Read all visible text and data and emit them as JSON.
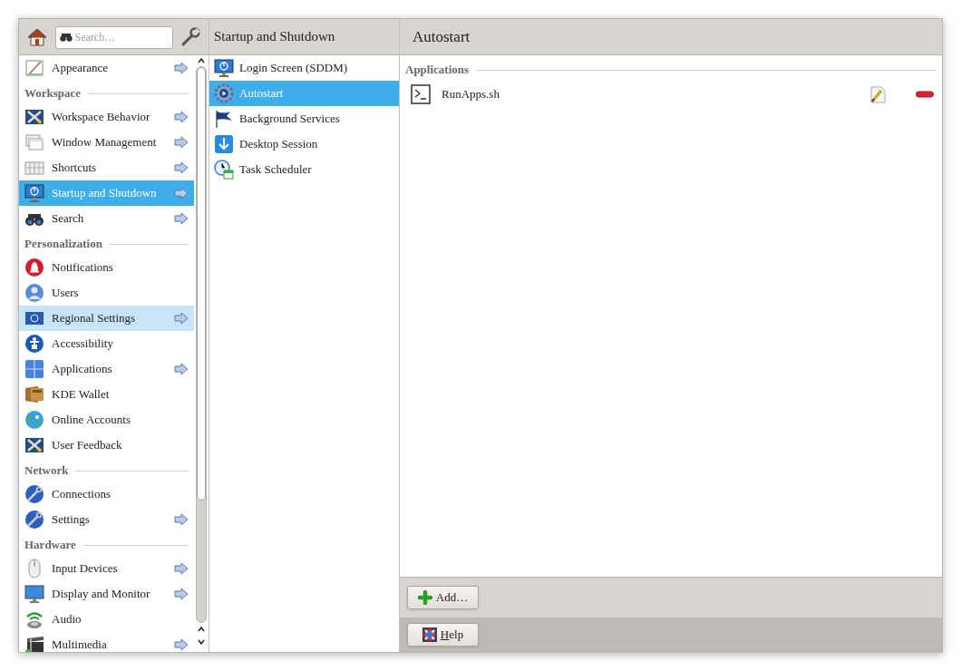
{
  "sidebar": {
    "search": {
      "placeholder": "Search…"
    },
    "items": [
      {
        "kind": "item",
        "label": "Appearance",
        "arrow": true,
        "selected": false,
        "hovered": false
      },
      {
        "kind": "header",
        "label": "Workspace"
      },
      {
        "kind": "item",
        "label": "Workspace Behavior",
        "arrow": true,
        "selected": false,
        "hovered": false
      },
      {
        "kind": "item",
        "label": "Window Management",
        "arrow": true,
        "selected": false,
        "hovered": false
      },
      {
        "kind": "item",
        "label": "Shortcuts",
        "arrow": true,
        "selected": false,
        "hovered": false
      },
      {
        "kind": "item",
        "label": "Startup and Shutdown",
        "arrow": true,
        "selected": true,
        "hovered": false
      },
      {
        "kind": "item",
        "label": "Search",
        "arrow": true,
        "selected": false,
        "hovered": false
      },
      {
        "kind": "header",
        "label": "Personalization"
      },
      {
        "kind": "item",
        "label": "Notifications",
        "arrow": false,
        "selected": false,
        "hovered": false
      },
      {
        "kind": "item",
        "label": "Users",
        "arrow": false,
        "selected": false,
        "hovered": false
      },
      {
        "kind": "item",
        "label": "Regional Settings",
        "arrow": true,
        "selected": false,
        "hovered": true
      },
      {
        "kind": "item",
        "label": "Accessibility",
        "arrow": false,
        "selected": false,
        "hovered": false
      },
      {
        "kind": "item",
        "label": "Applications",
        "arrow": true,
        "selected": false,
        "hovered": false
      },
      {
        "kind": "item",
        "label": "KDE Wallet",
        "arrow": false,
        "selected": false,
        "hovered": false
      },
      {
        "kind": "item",
        "label": "Online Accounts",
        "arrow": false,
        "selected": false,
        "hovered": false
      },
      {
        "kind": "item",
        "label": "User Feedback",
        "arrow": false,
        "selected": false,
        "hovered": false
      },
      {
        "kind": "header",
        "label": "Network"
      },
      {
        "kind": "item",
        "label": "Connections",
        "arrow": false,
        "selected": false,
        "hovered": false
      },
      {
        "kind": "item",
        "label": "Settings",
        "arrow": true,
        "selected": false,
        "hovered": false
      },
      {
        "kind": "header",
        "label": "Hardware"
      },
      {
        "kind": "item",
        "label": "Input Devices",
        "arrow": true,
        "selected": false,
        "hovered": false
      },
      {
        "kind": "item",
        "label": "Display and Monitor",
        "arrow": true,
        "selected": false,
        "hovered": false
      },
      {
        "kind": "item",
        "label": "Audio",
        "arrow": false,
        "selected": false,
        "hovered": false
      },
      {
        "kind": "item",
        "label": "Multimedia",
        "arrow": true,
        "selected": false,
        "hovered": false
      }
    ]
  },
  "category": {
    "title": "Startup and Shutdown",
    "items": [
      {
        "label": "Login Screen (SDDM)",
        "selected": false
      },
      {
        "label": "Autostart",
        "selected": true
      },
      {
        "label": "Background Services",
        "selected": false
      },
      {
        "label": "Desktop Session",
        "selected": false
      },
      {
        "label": "Task Scheduler",
        "selected": false
      }
    ]
  },
  "page": {
    "title": "Autostart",
    "sections": [
      {
        "title": "Applications",
        "entries": [
          {
            "name": "RunApps.sh"
          }
        ]
      }
    ],
    "buttons": [
      {
        "label": "Add…",
        "mnemonic": false
      }
    ],
    "footer_buttons": [
      {
        "label": "Help",
        "mnemonic": true
      }
    ]
  }
}
